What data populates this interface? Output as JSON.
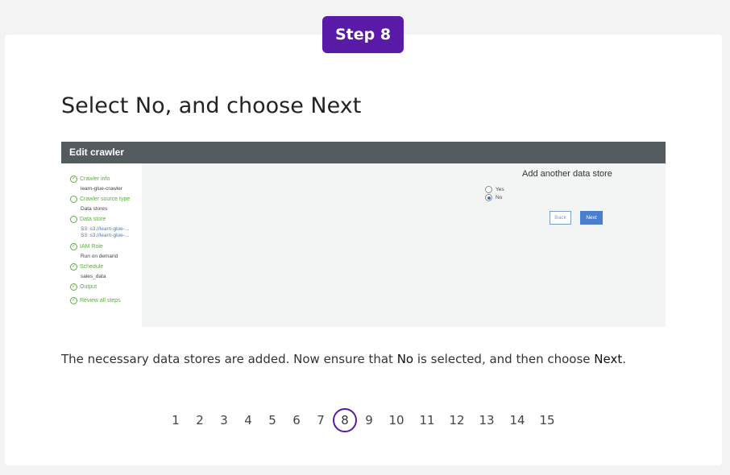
{
  "step_badge": "Step 8",
  "title": "Select No, and choose Next",
  "screenshot": {
    "header": "Edit crawler",
    "sidebar": [
      {
        "label": "Crawler info",
        "sub": [
          "learn-glue-crawler"
        ],
        "done": true
      },
      {
        "label": "Crawler source type",
        "sub": [
          "Data stores"
        ],
        "done": false
      },
      {
        "label": "Data store",
        "sub": [
          "S3: s3://learn-glue-...",
          "S3: s3://learn-glue-..."
        ],
        "done": false
      },
      {
        "label": "IAM Role",
        "sub": [
          "Run on demand"
        ],
        "done": true
      },
      {
        "label": "Schedule",
        "sub": [
          "sales_data"
        ],
        "done": true
      },
      {
        "label": "Output",
        "sub": [],
        "done": true
      },
      {
        "label": "Review all steps",
        "sub": [],
        "done": true
      }
    ],
    "main_title": "Add another data store",
    "radio_options": [
      "Yes",
      "No"
    ],
    "selected_option": "No",
    "back_label": "Back",
    "next_label": "Next"
  },
  "description": {
    "part1": "The necessary data stores are added. Now ensure that ",
    "no": "No",
    "part2": " is selected, and then choose ",
    "next": "Next",
    "part3": "."
  },
  "pagination": {
    "pages": [
      "1",
      "2",
      "3",
      "4",
      "5",
      "6",
      "7",
      "8",
      "9",
      "10",
      "11",
      "12",
      "13",
      "14",
      "15"
    ],
    "current": "8"
  },
  "colors": {
    "accent": "#5a1aa8",
    "header": "#545b5f",
    "done_green": "#5bb03a"
  }
}
